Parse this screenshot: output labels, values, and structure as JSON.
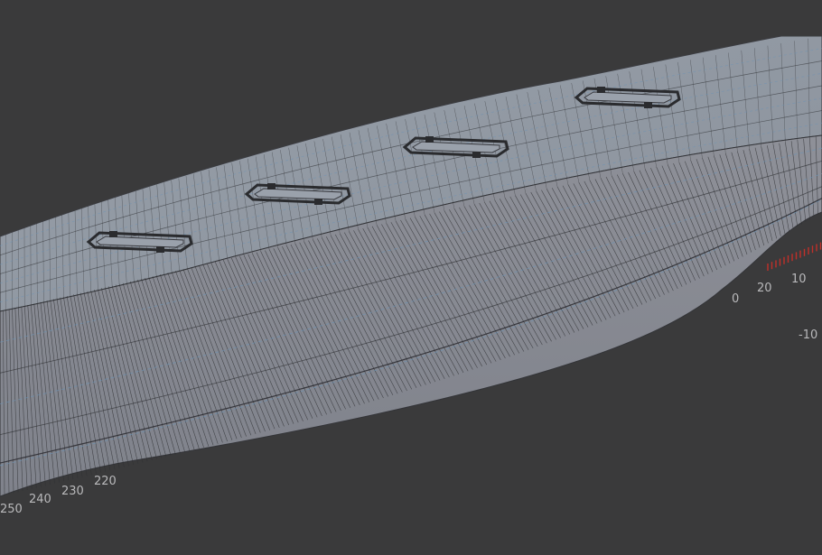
{
  "viewport": {
    "background": "#3a3a3b",
    "model": "ship-hull-mesh",
    "hull_color": "#8b8e97",
    "wire_color": "#2f3033",
    "highlight_color": "#6b93b5",
    "axis_tick_color": "#c0302a"
  },
  "axis_labels": {
    "bottom": [
      "250",
      "240",
      "230",
      "220"
    ],
    "right": [
      "20",
      "10",
      "0",
      "-10"
    ]
  },
  "hatches": 4
}
